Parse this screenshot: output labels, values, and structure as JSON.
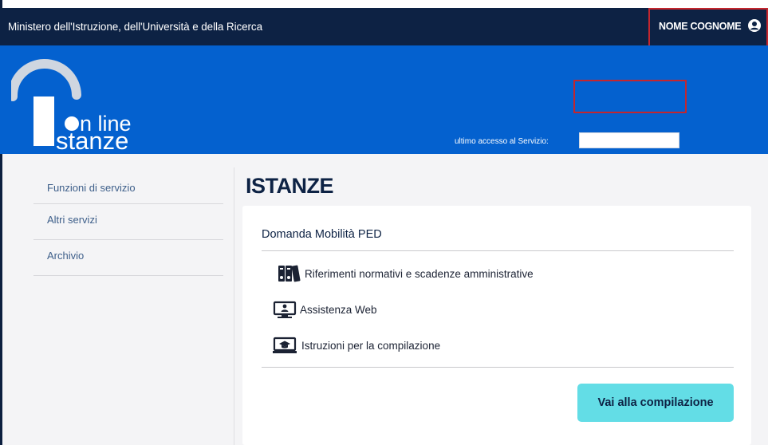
{
  "header": {
    "ministry": "Ministero dell'Istruzione, dell'Università e della Ricerca",
    "user_name": "NOME COGNOME",
    "user_icon": "user-circle-icon"
  },
  "banner": {
    "logo_line1": "n line",
    "logo_line2": "stanze",
    "last_access_label": "ultimo accesso al Servizio:",
    "last_access_value": ""
  },
  "sidebar": {
    "items": [
      {
        "label": "Funzioni di servizio"
      },
      {
        "label": "Altri servizi"
      },
      {
        "label": "Archivio"
      }
    ]
  },
  "main": {
    "title": "ISTANZE",
    "card": {
      "title": "Domanda Mobilità PED",
      "links": [
        {
          "label": "Riferimenti normativi e scadenze amministrative",
          "icon": "binders-icon"
        },
        {
          "label": "Assistenza Web",
          "icon": "monitor-person-icon"
        },
        {
          "label": "Istruzioni per la compilazione",
          "icon": "monitor-graduation-icon"
        }
      ],
      "button_label": "Vai alla compilazione"
    }
  },
  "colors": {
    "topbar": "#0d2244",
    "banner": "#0461cf",
    "accent_button": "#63dde6",
    "highlight_box": "#c4262e"
  }
}
